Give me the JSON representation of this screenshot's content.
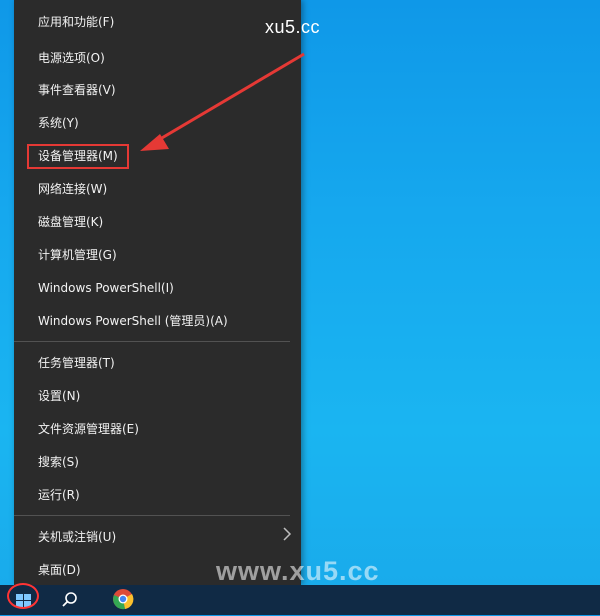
{
  "menu": {
    "items": [
      {
        "label": "应用和功能(F)"
      },
      {
        "label": "电源选项(O)"
      },
      {
        "label": "事件查看器(V)"
      },
      {
        "label": "系统(Y)"
      },
      {
        "label": "设备管理器(M)"
      },
      {
        "label": "网络连接(W)"
      },
      {
        "label": "磁盘管理(K)"
      },
      {
        "label": "计算机管理(G)"
      },
      {
        "label": "Windows PowerShell(I)"
      },
      {
        "label": "Windows PowerShell (管理员)(A)"
      },
      {
        "label": "任务管理器(T)"
      },
      {
        "label": "设置(N)"
      },
      {
        "label": "文件资源管理器(E)"
      },
      {
        "label": "搜索(S)"
      },
      {
        "label": "运行(R)"
      },
      {
        "label": "关机或注销(U)"
      },
      {
        "label": "桌面(D)"
      }
    ]
  },
  "watermarks": {
    "top": "xu5.cc",
    "bottom": "www.xu5.cc"
  },
  "colors": {
    "menu_background": "#2b2b2b",
    "menu_text": "#f2f2f2",
    "highlight": "#e53935",
    "desktop": "#16a8ee",
    "taskbar": "#102a45"
  },
  "icons": {
    "submenu": "chevron-right-icon",
    "start": "windows-logo-icon",
    "search": "search-icon",
    "browser": "chrome-icon"
  }
}
